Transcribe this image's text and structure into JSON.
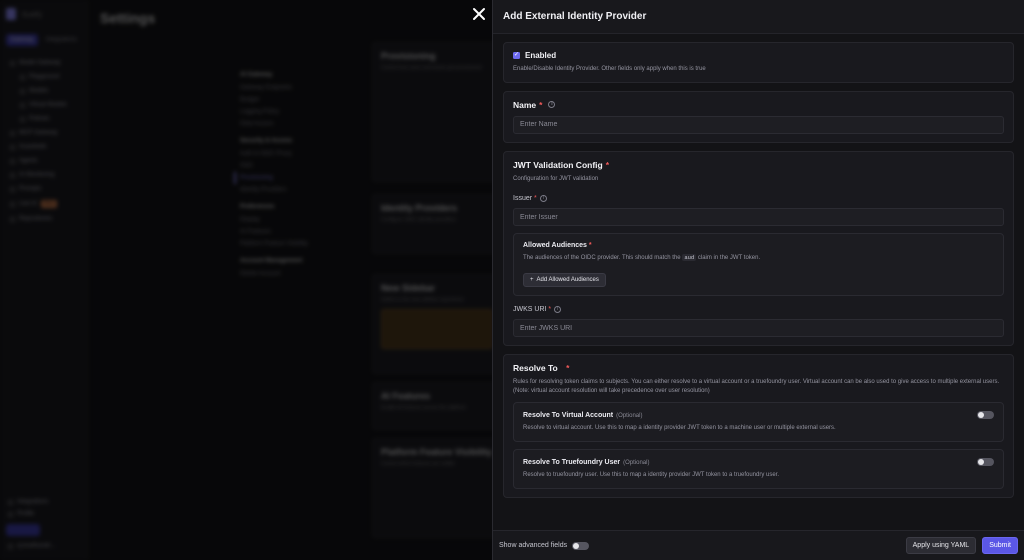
{
  "background": {
    "app_title": "Settings",
    "logo_text": "truefy",
    "sidebar_tabs": [
      "Gateway",
      "Integrations"
    ],
    "sidebar_items": [
      {
        "label": "Model Gateway",
        "sub": false
      },
      {
        "label": "Playground",
        "sub": true
      },
      {
        "label": "Models",
        "sub": true
      },
      {
        "label": "Virtual Models",
        "sub": true
      },
      {
        "label": "Policies",
        "sub": true
      },
      {
        "label": "MCP Gateway",
        "sub": false
      },
      {
        "label": "Guardrails",
        "sub": false
      },
      {
        "label": "Agents",
        "sub": false
      },
      {
        "label": "AI Monitoring",
        "sub": false
      },
      {
        "label": "Prompts",
        "sub": false
      },
      {
        "label": "Live AI",
        "sub": false,
        "badge": "Beta"
      },
      {
        "label": "Repositories",
        "sub": false
      }
    ],
    "sidebar_footer": [
      "Integrations",
      "Profile"
    ],
    "sidebar_user": "sj.truefoundr...",
    "mid_nav": [
      {
        "group": "AI Gateway",
        "links": [
          "Gateway Endpoints",
          "Budget",
          "Logging Policy",
          "Data Access"
        ]
      },
      {
        "group": "Security & Access",
        "links": [
          "Auth & OIDC Proxy",
          "SSO",
          "Provisioning",
          "Identity Providers"
        ],
        "active": "Provisioning"
      },
      {
        "group": "Preferences",
        "links": [
          "Display",
          "AI Features",
          "Platform Feature Visibility"
        ]
      },
      {
        "group": "Account Management",
        "links": [
          "Delete Account"
        ]
      }
    ],
    "cards": [
      {
        "title": "Provisioning",
        "sub": "Control how users and teams get provisioned"
      },
      {
        "title": "Identity Providers",
        "sub": "Configure OIDC identity providers"
      },
      {
        "title": "New Sidebar",
        "sub": "Switch to the new sidebar experience"
      },
      {
        "title": "AI Features",
        "sub": "Enable AI features across the platform"
      },
      {
        "title": "Platform Feature Visibility",
        "sub": "Control which features are visible"
      }
    ]
  },
  "drawer": {
    "title": "Add External Identity Provider",
    "enabled": {
      "label": "Enabled",
      "checked": true,
      "help": "Enable/Disable Identity Provider. Other fields only apply when this is true"
    },
    "name": {
      "label": "Name",
      "required": "*",
      "placeholder": "Enter Name"
    },
    "jwt": {
      "title": "JWT Validation Config",
      "required": "*",
      "help": "Configuration for JWT validation",
      "issuer": {
        "label": "Issuer",
        "required": "*",
        "placeholder": "Enter Issuer"
      },
      "audiences": {
        "title": "Allowed Audiences",
        "required": "*",
        "help_pre": "The audiences of the OIDC provider. This should match the",
        "help_code": "aud",
        "help_post": "claim in the JWT token.",
        "add_label": "Add Allowed Audiences"
      },
      "jwks": {
        "label": "JWKS URI",
        "required": "*",
        "placeholder": "Enter JWKS URI"
      }
    },
    "resolve": {
      "title": "Resolve To",
      "required": "*",
      "help": "Rules for resolving token claims to subjects. You can either resolve to a virtual account or a truefoundry user. Virtual account can be also used to give access to multiple external users. (Note: virtual account resolution will take precedence over user resolution)",
      "virtual": {
        "title": "Resolve To Virtual Account",
        "optional": "(Optional)",
        "help": "Resolve to virtual account. Use this to map a identity provider JWT token to a machine user or multiple external users.",
        "on": false
      },
      "user": {
        "title": "Resolve To Truefoundry User",
        "optional": "(Optional)",
        "help": "Resolve to truefoundry user. Use this to map a identity provider JWT token to a truefoundry user.",
        "on": false
      }
    },
    "footer": {
      "advanced_label": "Show advanced fields",
      "advanced_on": false,
      "yaml_label": "Apply using YAML",
      "submit_label": "Submit"
    }
  },
  "colors": {
    "accent": "#5b57e6",
    "required": "#f25a5a",
    "background": "#131316"
  }
}
